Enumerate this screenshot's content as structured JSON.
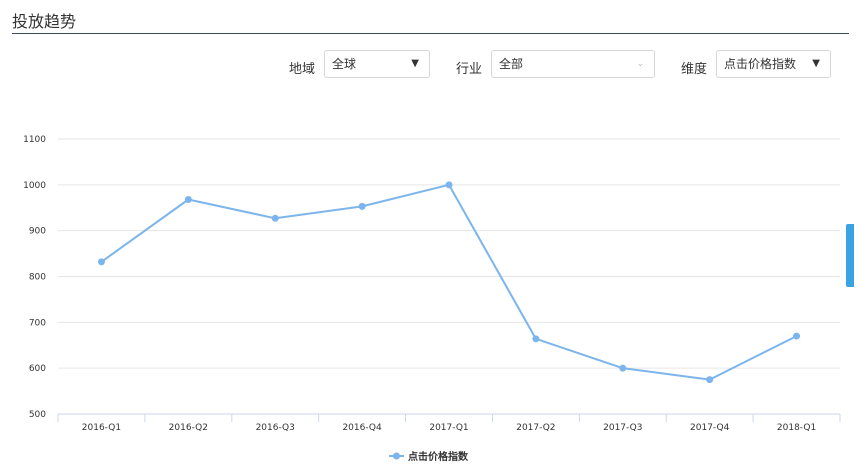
{
  "header": {
    "title": "投放趋势"
  },
  "filters": {
    "region": {
      "label": "地域",
      "value": "全球"
    },
    "industry": {
      "label": "行业",
      "value": "全部"
    },
    "dimension": {
      "label": "维度",
      "value": "点击价格指数"
    }
  },
  "icons": {
    "dropdown": "chevron-down-icon"
  },
  "colors": {
    "series": "#7cb5ec",
    "accent": "#3aa3e3"
  },
  "chart_data": {
    "type": "line",
    "categories": [
      "2016-Q1",
      "2016-Q2",
      "2016-Q3",
      "2016-Q4",
      "2017-Q1",
      "2017-Q2",
      "2017-Q3",
      "2017-Q4",
      "2018-Q1"
    ],
    "series": [
      {
        "name": "点击价格指数",
        "values": [
          832,
          968,
          927,
          953,
          1000,
          664,
          600,
          575,
          670
        ]
      }
    ],
    "ylim": [
      500,
      1100
    ],
    "yticks": [
      500,
      600,
      700,
      800,
      900,
      1000,
      1100
    ],
    "grid": true,
    "legend": "bottom-center"
  }
}
